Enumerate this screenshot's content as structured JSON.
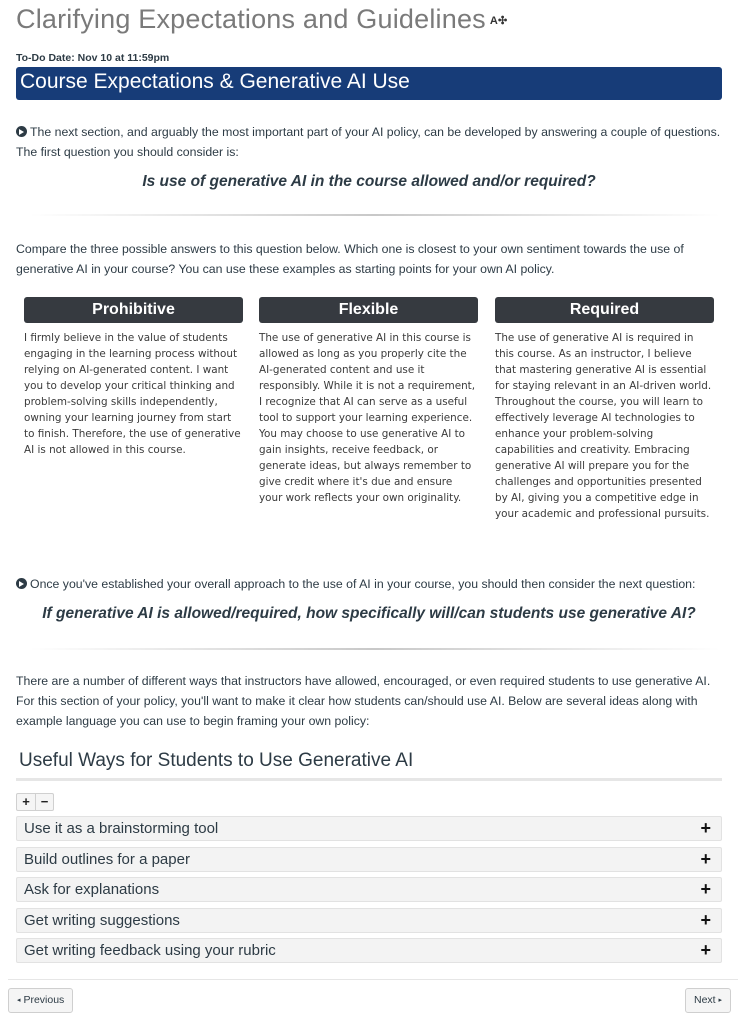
{
  "header": {
    "title": "Clarifying Expectations and Guidelines",
    "title_icon": "accessibility-check-icon",
    "title_icon_glyph": "A✣",
    "todo_date": "To-Do Date: Nov 10 at 11:59pm",
    "banner": "Course Expectations & Generative AI Use"
  },
  "section1": {
    "intro": "The next section, and arguably the most important part of your AI policy, can be developed by answering a couple of questions. The first question you should consider is:",
    "question": "Is use of generative AI in the course allowed and/or required?",
    "compare_text": "Compare the three possible answers to this question below. Which one is closest to your own sentiment towards the use of generative AI in your course? You can use these examples as starting points for your own AI policy."
  },
  "columns": [
    {
      "heading": "Prohibitive",
      "body": "I firmly believe in the value of students engaging in the learning process without relying on AI-generated content. I want you to develop your critical thinking and problem-solving skills independently, owning your learning journey from start to finish. Therefore, the use of generative AI is not allowed in this course."
    },
    {
      "heading": "Flexible",
      "body": "The use of generative AI in this course is allowed as long as you properly cite the AI-generated content and use it responsibly. While it is not a requirement, I recognize that AI can serve as a useful tool to support your learning experience. You may choose to use generative AI to gain insights, receive feedback, or generate ideas, but always remember to give credit where it's due and ensure your work reflects your own originality."
    },
    {
      "heading": "Required",
      "body": "The use of generative AI is required in this course. As an instructor, I believe that mastering generative AI is essential for staying relevant in an AI-driven world. Throughout the course, you will learn to effectively leverage AI technologies to enhance your problem-solving capabilities and creativity. Embracing generative AI will prepare you for the challenges and opportunities presented by AI, giving you a competitive edge in your academic and professional pursuits."
    }
  ],
  "section2": {
    "intro": "Once you've established your overall approach to the use of AI in your course, you should then consider the next question:",
    "question": "If generative AI is allowed/required, how specifically will/can students use generative AI?",
    "body": "There are a number of different ways that instructors have allowed, encouraged, or even required students to use generative AI. For this section of your policy, you'll want to make it clear how students can/should use AI. Below are several ideas along with example language you can use to begin framing your own policy:"
  },
  "accordion": {
    "title": "Useful Ways for Students to Use Generative AI",
    "expand_all": "+",
    "collapse_all": "−",
    "item_icon": "+",
    "items": [
      {
        "label": "Use it as a brainstorming tool"
      },
      {
        "label": "Build outlines for a paper"
      },
      {
        "label": "Ask for explanations"
      },
      {
        "label": "Get writing suggestions"
      },
      {
        "label": "Get writing feedback using your rubric"
      }
    ]
  },
  "footer": {
    "previous": "Previous",
    "next": "Next",
    "prev_glyph": "◂",
    "next_glyph": "▸"
  },
  "colors": {
    "banner": "#173c78",
    "column_header": "#363a40",
    "accordion_item": "#f3f3f3"
  }
}
